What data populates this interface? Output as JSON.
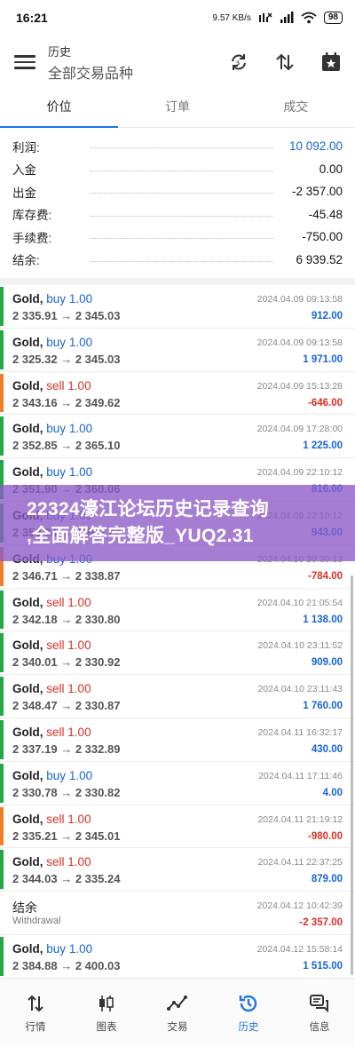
{
  "status": {
    "time": "16:21",
    "net_speed": "9.57 KB/s",
    "battery": "98"
  },
  "header": {
    "title": "历史",
    "subtitle": "全部交易品种"
  },
  "tabs": [
    {
      "label": "价位"
    },
    {
      "label": "订单"
    },
    {
      "label": "成交"
    }
  ],
  "summary": [
    {
      "label": "利润:",
      "value": "10 092.00",
      "highlight": true
    },
    {
      "label": "入金",
      "value": "0.00"
    },
    {
      "label": "出金",
      "value": "-2 357.00"
    },
    {
      "label": "库存费:",
      "value": "-45.48"
    },
    {
      "label": "手续费:",
      "value": "-750.00"
    },
    {
      "label": "结余:",
      "value": "6 939.52"
    }
  ],
  "deals": [
    {
      "symbol": "Gold,",
      "type": "buy",
      "lots": "1.00",
      "prices": "2 335.91 → 2 345.03",
      "date": "2024.04.09 09:13:58",
      "profit": "912.00",
      "color": "#23a845"
    },
    {
      "symbol": "Gold,",
      "type": "buy",
      "lots": "1.00",
      "prices": "2 325.32 → 2 345.03",
      "date": "2024.04.09 09:13:58",
      "profit": "1 971.00",
      "color": "#23a845"
    },
    {
      "symbol": "Gold,",
      "type": "sell",
      "lots": "1.00",
      "prices": "2 343.16 → 2 349.62",
      "date": "2024.04.09 15:13:28",
      "profit": "-646.00",
      "color": "#f07e26"
    },
    {
      "symbol": "Gold,",
      "type": "buy",
      "lots": "1.00",
      "prices": "2 352.85 → 2 365.10",
      "date": "2024.04.09 17:28:00",
      "profit": "1 225.00",
      "color": "#23a845"
    },
    {
      "symbol": "Gold,",
      "type": "buy",
      "lots": "1.00",
      "prices": "2 351.90 → 2 360.06",
      "date": "2024.04.09 22:10:12",
      "profit": "816.00",
      "color": "#23a845"
    },
    {
      "symbol": "Gold,",
      "type": "buy",
      "lots": "1.00",
      "prices": "2 350.84 → 2 360.27",
      "date": "2024.04.09 22:10:12",
      "profit": "943.00",
      "color": "#23a845"
    },
    {
      "symbol": "Gold,",
      "type": "buy",
      "lots": "1.00",
      "prices": "2 346.71 → 2 338.87",
      "date": "2024.04.10 20:30:13",
      "profit": "-784.00",
      "color": "#f07e26"
    },
    {
      "symbol": "Gold,",
      "type": "sell",
      "lots": "1.00",
      "prices": "2 342.18 → 2 330.80",
      "date": "2024.04.10 21:05:54",
      "profit": "1 138.00",
      "color": "#23a845"
    },
    {
      "symbol": "Gold,",
      "type": "sell",
      "lots": "1.00",
      "prices": "2 340.01 → 2 330.92",
      "date": "2024.04.10 23:11:52",
      "profit": "909.00",
      "color": "#23a845"
    },
    {
      "symbol": "Gold,",
      "type": "sell",
      "lots": "1.00",
      "prices": "2 348.47 → 2 330.87",
      "date": "2024.04.10 23:11:43",
      "profit": "1 760.00",
      "color": "#23a845"
    },
    {
      "symbol": "Gold,",
      "type": "sell",
      "lots": "1.00",
      "prices": "2 337.19 → 2 332.89",
      "date": "2024.04.11 16:32:17",
      "profit": "430.00",
      "color": "#23a845"
    },
    {
      "symbol": "Gold,",
      "type": "buy",
      "lots": "1.00",
      "prices": "2 330.78 → 2 330.82",
      "date": "2024.04.11 17:11:46",
      "profit": "4.00",
      "color": "#23a845"
    },
    {
      "symbol": "Gold,",
      "type": "sell",
      "lots": "1.00",
      "prices": "2 335.21 → 2 345.01",
      "date": "2024.04.11 21:19:12",
      "profit": "-980.00",
      "color": "#f07e26"
    },
    {
      "symbol": "Gold,",
      "type": "sell",
      "lots": "1.00",
      "prices": "2 344.03 → 2 335.24",
      "date": "2024.04.11 22:37:25",
      "profit": "879.00",
      "color": "#23a845"
    },
    {
      "balance": true,
      "symbol": "结余",
      "sub": "Withdrawal",
      "date": "2024.04.12 10:42:39",
      "profit": "-2 357.00",
      "color": ""
    },
    {
      "symbol": "Gold,",
      "type": "buy",
      "lots": "1.00",
      "prices": "2 384.88 → 2 400.03",
      "date": "2024.04.12 15:58:14",
      "profit": "1 515.00",
      "color": "#23a845"
    }
  ],
  "overlay": {
    "line1": "22324濠江论坛历史记录查询",
    "line2": ",全面解答完整版_YUQ2.31"
  },
  "nav": [
    {
      "label": "行情",
      "icon": "quotes-icon"
    },
    {
      "label": "图表",
      "icon": "chart-icon"
    },
    {
      "label": "交易",
      "icon": "trade-icon"
    },
    {
      "label": "历史",
      "icon": "history-icon",
      "active": true
    },
    {
      "label": "信息",
      "icon": "messages-icon"
    }
  ],
  "colors": {
    "accent": "#1e74e8",
    "profit_positive": "#1565d8",
    "profit_negative": "#d93025",
    "buy_bar": "#23a845",
    "sell_bar": "#f07e26"
  }
}
